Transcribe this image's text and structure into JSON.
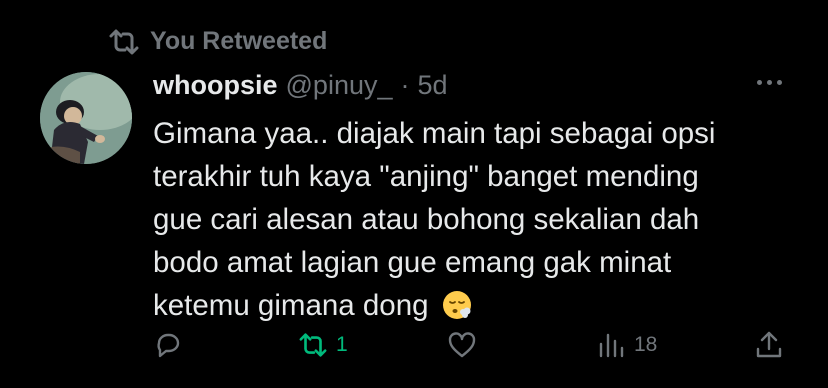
{
  "retweet_banner": {
    "label": "You Retweeted",
    "icon": "retweet-icon"
  },
  "tweet": {
    "display_name": "whoopsie",
    "handle": "@pinuy_",
    "separator": "·",
    "time": "5d",
    "text": "Gimana yaa.. diajak main tapi sebagai opsi\nterakhir tuh kaya \"anjing\" banget mending\ngue cari alesan atau bohong sekalian dah\nbodo amat lagian gue emang gak minat\nketemu gimana dong",
    "emoji": "face-exhaling-emoji"
  },
  "actions": {
    "reply": {
      "icon": "reply-icon",
      "count": ""
    },
    "retweet": {
      "icon": "retweet-icon",
      "count": "1",
      "active_color": "#00ba7c"
    },
    "like": {
      "icon": "heart-icon",
      "count": ""
    },
    "views": {
      "icon": "views-icon",
      "count": "18"
    },
    "share": {
      "icon": "share-icon"
    }
  },
  "colors": {
    "background": "#000000",
    "text": "#e7e9ea",
    "muted": "#71767b",
    "retweet_active": "#00ba7c"
  }
}
